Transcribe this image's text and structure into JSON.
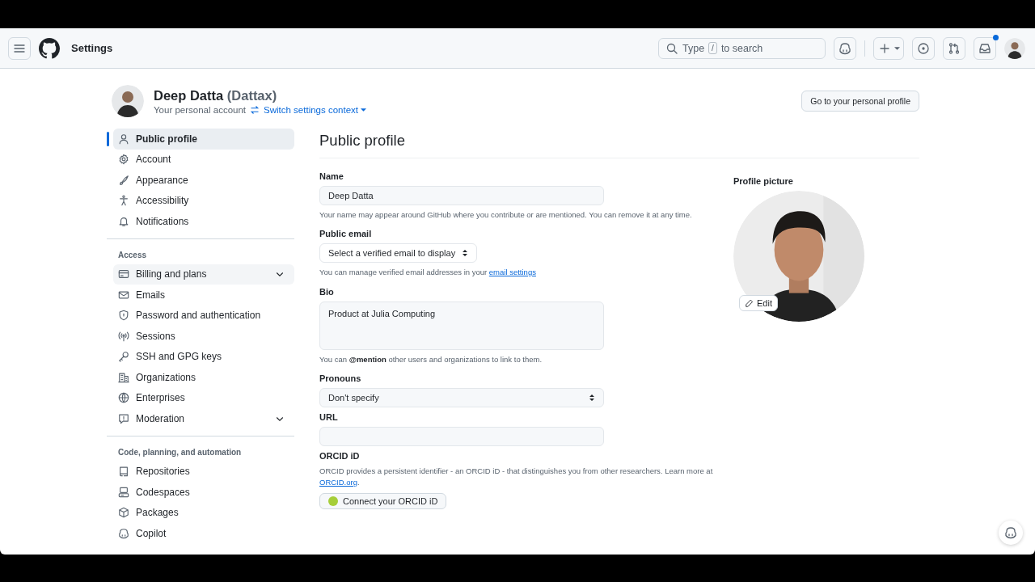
{
  "header": {
    "title": "Settings",
    "search": {
      "prefix": "Type",
      "key": "/",
      "suffix": "to search"
    },
    "inbox": {
      "unread": true
    }
  },
  "account": {
    "name": "Deep Datta",
    "login": "(Dattax)",
    "subtitle": "Your personal account",
    "switch_link": "Switch settings context",
    "profile_button": "Go to your personal profile"
  },
  "sidebar": {
    "groups": [
      {
        "items": [
          {
            "label": "Public profile",
            "selected": true,
            "expandable": false
          },
          {
            "label": "Account",
            "selected": false,
            "expandable": false
          },
          {
            "label": "Appearance",
            "selected": false,
            "expandable": false
          },
          {
            "label": "Accessibility",
            "selected": false,
            "expandable": false
          },
          {
            "label": "Notifications",
            "selected": false,
            "expandable": false
          }
        ]
      },
      {
        "heading": "Access",
        "items": [
          {
            "label": "Billing and plans",
            "selected": false,
            "hovered": true,
            "expandable": true
          },
          {
            "label": "Emails",
            "selected": false,
            "expandable": false
          },
          {
            "label": "Password and authentication",
            "selected": false,
            "expandable": false
          },
          {
            "label": "Sessions",
            "selected": false,
            "expandable": false
          },
          {
            "label": "SSH and GPG keys",
            "selected": false,
            "expandable": false
          },
          {
            "label": "Organizations",
            "selected": false,
            "expandable": false
          },
          {
            "label": "Enterprises",
            "selected": false,
            "expandable": false
          },
          {
            "label": "Moderation",
            "selected": false,
            "expandable": true
          }
        ]
      },
      {
        "heading": "Code, planning, and automation",
        "items": [
          {
            "label": "Repositories",
            "selected": false,
            "expandable": false
          },
          {
            "label": "Codespaces",
            "selected": false,
            "expandable": false
          },
          {
            "label": "Packages",
            "selected": false,
            "expandable": false
          },
          {
            "label": "Copilot",
            "selected": false,
            "expandable": false
          }
        ]
      }
    ]
  },
  "main": {
    "title": "Public profile",
    "fields": [
      {
        "kind": "text",
        "label": "Name",
        "value": "Deep Datta",
        "help": "Your name may appear around GitHub where you contribute or are mentioned. You can remove it at any time."
      },
      {
        "kind": "select-narrow",
        "label": "Public email",
        "value": "Select a verified email to display",
        "help": "You can manage verified email addresses in your",
        "help_link": "email settings"
      },
      {
        "kind": "textarea",
        "label": "Bio",
        "value": "Product at Julia Computing",
        "help": "You can **@mention** other users and organizations to link to them."
      },
      {
        "kind": "select",
        "label": "Pronouns",
        "value": "Don't specify"
      },
      {
        "kind": "text",
        "label": "URL"
      },
      {
        "kind": "info",
        "label": "ORCID iD",
        "help": "ORCID provides a persistent identifier - an ORCID iD - that distinguishes you from other researchers. Learn more at",
        "help_link": "ORCID.org",
        "help_tail": ".",
        "button": "Connect your ORCID iD"
      }
    ],
    "picture": {
      "label": "Profile picture",
      "edit": "Edit"
    }
  }
}
